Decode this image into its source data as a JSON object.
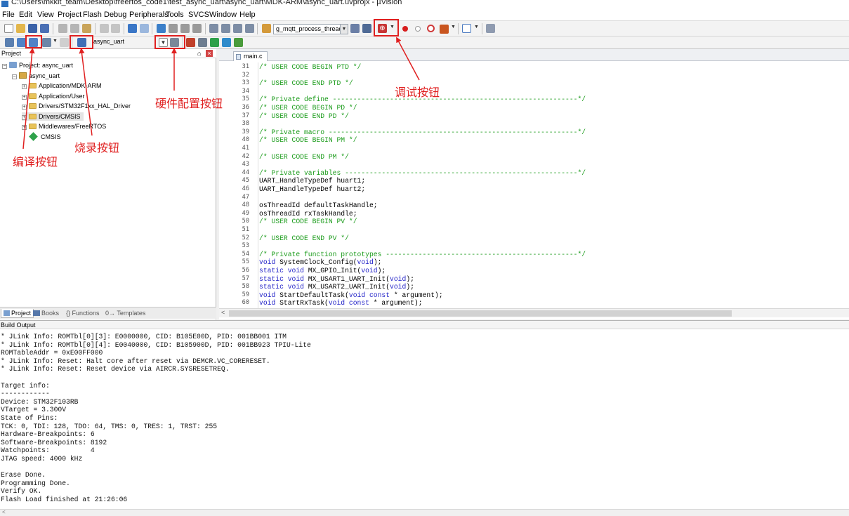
{
  "window": {
    "title": "C:\\Users\\mkkit_team\\Desktop\\freertos_code1\\test_async_uart\\async_uart\\MDK-ARM\\async_uart.uvprojx - µVision"
  },
  "menu": [
    "File",
    "Edit",
    "View",
    "Project",
    "Flash",
    "Debug",
    "Peripherals",
    "Tools",
    "SVCS",
    "Window",
    "Help"
  ],
  "toolbar": {
    "find_combo": "g_mqtt_process_thread_r",
    "target_combo": "async_uart"
  },
  "project_panel": {
    "title": "Project",
    "pin_glyph": "⌂",
    "close_glyph": "×",
    "root": "Project: async_uart",
    "target": "async_uart",
    "groups": [
      "Application/MDK-ARM",
      "Application/User",
      "Drivers/STM32F1xx_HAL_Driver",
      "Drivers/CMSIS",
      "Middlewares/FreeRTOS"
    ],
    "component": "CMSIS",
    "tabs": [
      "Project",
      "Books",
      "{} Functions",
      "0→ Templates"
    ]
  },
  "editor": {
    "tab": "main.c",
    "lines": [
      {
        "n": "31",
        "t": "/* USER CODE BEGIN PTD */",
        "k": "cm"
      },
      {
        "n": "32",
        "t": "",
        "k": "tx"
      },
      {
        "n": "33",
        "t": "/* USER CODE END PTD */",
        "k": "cm"
      },
      {
        "n": "34",
        "t": "",
        "k": "tx"
      },
      {
        "n": "35",
        "t": "/* Private define ------------------------------------------------------------*/",
        "k": "cm"
      },
      {
        "n": "36",
        "t": "/* USER CODE BEGIN PD */",
        "k": "cm"
      },
      {
        "n": "37",
        "t": "/* USER CODE END PD */",
        "k": "cm"
      },
      {
        "n": "38",
        "t": "",
        "k": "tx"
      },
      {
        "n": "39",
        "t": "/* Private macro -------------------------------------------------------------*/",
        "k": "cm"
      },
      {
        "n": "40",
        "t": "/* USER CODE BEGIN PM */",
        "k": "cm"
      },
      {
        "n": "41",
        "t": "",
        "k": "tx"
      },
      {
        "n": "42",
        "t": "/* USER CODE END PM */",
        "k": "cm"
      },
      {
        "n": "43",
        "t": "",
        "k": "tx"
      },
      {
        "n": "44",
        "t": "/* Private variables ---------------------------------------------------------*/",
        "k": "cm"
      },
      {
        "n": "45",
        "t": "UART_HandleTypeDef huart1;",
        "k": "tx"
      },
      {
        "n": "46",
        "t": "UART_HandleTypeDef huart2;",
        "k": "tx"
      },
      {
        "n": "47",
        "t": "",
        "k": "tx"
      },
      {
        "n": "48",
        "t": "osThreadId defaultTaskHandle;",
        "k": "tx"
      },
      {
        "n": "49",
        "t": "osThreadId rxTaskHandle;",
        "k": "tx"
      },
      {
        "n": "50",
        "t": "/* USER CODE BEGIN PV */",
        "k": "cm"
      },
      {
        "n": "51",
        "t": "",
        "k": "tx"
      },
      {
        "n": "52",
        "t": "/* USER CODE END PV */",
        "k": "cm"
      },
      {
        "n": "53",
        "t": "",
        "k": "tx"
      },
      {
        "n": "54",
        "t": "/* Private function prototypes -----------------------------------------------*/",
        "k": "cm"
      },
      {
        "n": "55",
        "t": "void SystemClock_Config(void);",
        "k": "mixed",
        "parts": [
          [
            "kw",
            "void"
          ],
          [
            "tx",
            " SystemClock_Config("
          ],
          [
            "kw",
            "void"
          ],
          [
            "tx",
            ");"
          ]
        ]
      },
      {
        "n": "56",
        "t": "static void MX_GPIO_Init(void);",
        "k": "mixed",
        "parts": [
          [
            "kw",
            "static void"
          ],
          [
            "tx",
            " MX_GPIO_Init("
          ],
          [
            "kw",
            "void"
          ],
          [
            "tx",
            ");"
          ]
        ]
      },
      {
        "n": "57",
        "t": "static void MX_USART1_UART_Init(void);",
        "k": "mixed",
        "parts": [
          [
            "kw",
            "static void"
          ],
          [
            "tx",
            " MX_USART1_UART_Init("
          ],
          [
            "kw",
            "void"
          ],
          [
            "tx",
            ");"
          ]
        ]
      },
      {
        "n": "58",
        "t": "static void MX_USART2_UART_Init(void);",
        "k": "mixed",
        "parts": [
          [
            "kw",
            "static void"
          ],
          [
            "tx",
            " MX_USART2_UART_Init("
          ],
          [
            "kw",
            "void"
          ],
          [
            "tx",
            ");"
          ]
        ]
      },
      {
        "n": "59",
        "t": "void StartDefaultTask(void const * argument);",
        "k": "mixed",
        "parts": [
          [
            "kw",
            "void"
          ],
          [
            "tx",
            " StartDefaultTask("
          ],
          [
            "kw",
            "void const"
          ],
          [
            "tx",
            " * argument);"
          ]
        ]
      },
      {
        "n": "60",
        "t": "void StartRxTask(void const * argument);",
        "k": "mixed",
        "parts": [
          [
            "kw",
            "void"
          ],
          [
            "tx",
            " StartRxTask("
          ],
          [
            "kw",
            "void const"
          ],
          [
            "tx",
            " * argument);"
          ]
        ]
      }
    ]
  },
  "build_output": {
    "title": "Build Output",
    "lines": [
      "* JLink Info: ROMTbl[0][3]: E0000000, CID: B105E00D, PID: 001BB001 ITM",
      "* JLink Info: ROMTbl[0][4]: E0040000, CID: B105900D, PID: 001BB923 TPIU-Lite",
      "ROMTableAddr = 0xE00FF000",
      "* JLink Info: Reset: Halt core after reset via DEMCR.VC_CORERESET.",
      "* JLink Info: Reset: Reset device via AIRCR.SYSRESETREQ.",
      "",
      "Target info:",
      "------------",
      "Device: STM32F103RB",
      "VTarget = 3.300V",
      "State of Pins:",
      "TCK: 0, TDI: 128, TDO: 64, TMS: 0, TRES: 1, TRST: 255",
      "Hardware-Breakpoints: 6",
      "Software-Breakpoints: 8192",
      "Watchpoints:          4",
      "JTAG speed: 4000 kHz",
      "",
      "Erase Done.",
      "Programming Done.",
      "Verify OK.",
      "Flash Load finished at 21:26:06"
    ]
  },
  "annotations": {
    "compile": "编译按钮",
    "download": "烧录按钮",
    "hardware_config": "硬件配置按钮",
    "debug": "调试按钮"
  },
  "colors": {
    "annotation_red": "#e02020",
    "comment_green": "#1a9b1a",
    "keyword_blue": "#2323c8"
  }
}
